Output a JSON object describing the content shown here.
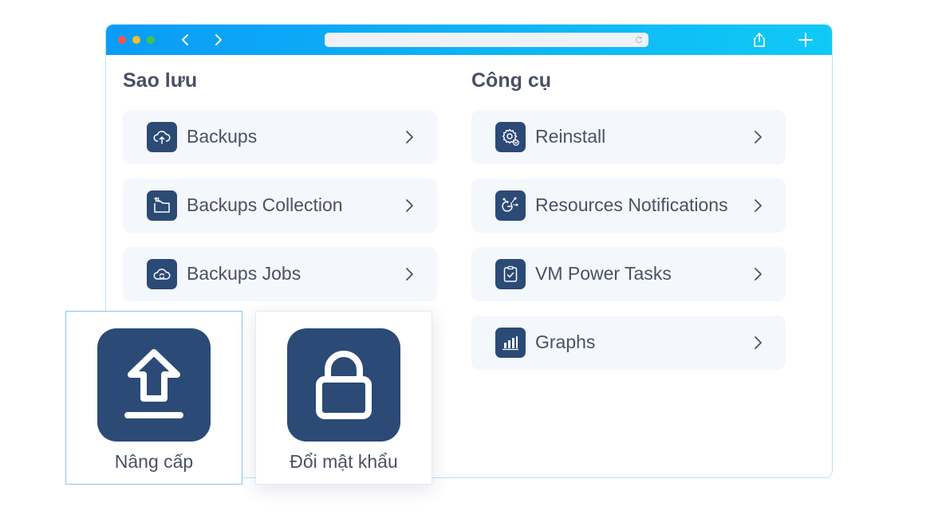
{
  "browser": {
    "back_icon": "chevron-left-icon",
    "forward_icon": "chevron-right-icon",
    "reload_icon": "reload-icon",
    "share_icon": "share-icon",
    "new_tab_icon": "plus-icon"
  },
  "backup_section": {
    "title": "Sao lưu",
    "items": [
      {
        "label": "Backups",
        "icon": "cloud-upload-icon"
      },
      {
        "label": "Backups Collection",
        "icon": "folder-transfer-icon"
      },
      {
        "label": "Backups Jobs",
        "icon": "cloud-sync-icon"
      }
    ]
  },
  "tools_section": {
    "title": "Công cụ",
    "items": [
      {
        "label": "Reinstall",
        "icon": "gear-icon"
      },
      {
        "label": "Resources Notifications",
        "icon": "resources-icon"
      },
      {
        "label": "VM Power Tasks",
        "icon": "clipboard-check-icon"
      },
      {
        "label": "Graphs",
        "icon": "bar-chart-icon"
      }
    ]
  },
  "cards": [
    {
      "label": "Nâng cấp",
      "icon": "upload-icon"
    },
    {
      "label": "Đổi mật khẩu",
      "icon": "lock-icon"
    }
  ],
  "colors": {
    "titlebar_start": "#0b9cf6",
    "titlebar_end": "#10c9f6",
    "icon_background": "#2c4a76",
    "item_background": "#f4f7fb"
  }
}
